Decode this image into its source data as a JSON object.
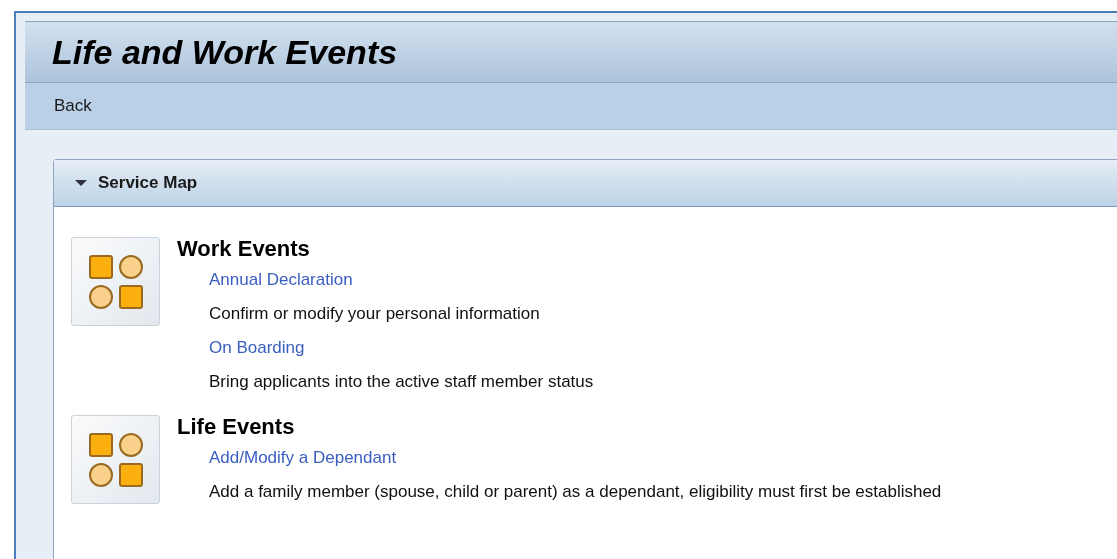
{
  "page": {
    "title": "Life and Work Events"
  },
  "toolbar": {
    "items": [
      {
        "label": "Back"
      }
    ]
  },
  "panel": {
    "title": "Service Map",
    "expanded": true,
    "groups": [
      {
        "title": "Work Events",
        "services": [
          {
            "link": "Annual Declaration",
            "description": "Confirm or modify your personal information"
          },
          {
            "link": "On Boarding",
            "description": "Bring applicants into the active staff member status"
          }
        ]
      },
      {
        "title": "Life Events",
        "services": [
          {
            "link": "Add/Modify a Dependant",
            "description": "Add a family member (spouse, child or parent) as a dependant, eligibility must first be established"
          }
        ]
      }
    ]
  }
}
